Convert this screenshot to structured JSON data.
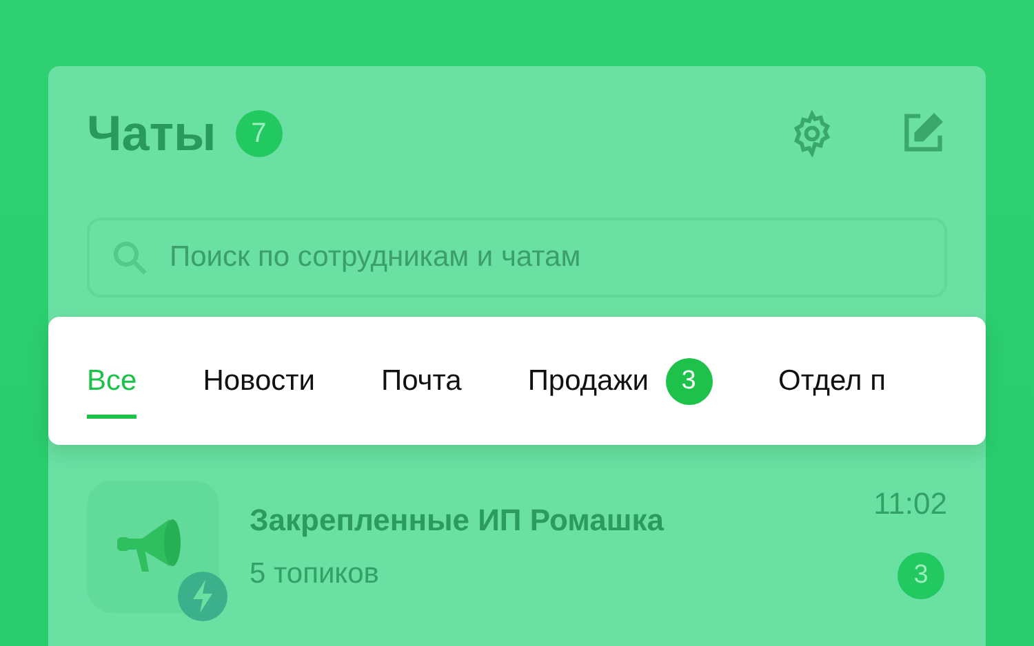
{
  "header": {
    "title": "Чаты",
    "badge": "7"
  },
  "search": {
    "placeholder": "Поиск по сотрудникам и чатам"
  },
  "tabs": [
    {
      "label": "Все",
      "selected": true
    },
    {
      "label": "Новости",
      "selected": false
    },
    {
      "label": "Почта",
      "selected": false
    },
    {
      "label": "Продажи",
      "selected": false,
      "badge": "3"
    },
    {
      "label": "Отдел п",
      "selected": false
    }
  ],
  "chats": [
    {
      "title": "Закрепленные ИП Ромашка",
      "subtitle": "5 топиков",
      "time": "11:02",
      "unread": "3"
    }
  ]
}
